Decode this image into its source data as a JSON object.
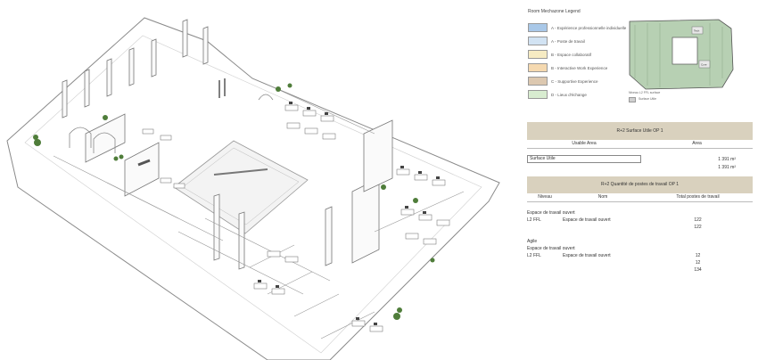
{
  "legend": {
    "title": "Room Mechazone Legend",
    "items": [
      {
        "label": "A - Expérience professionnelle individuelle",
        "color": "#a9c8e8"
      },
      {
        "label": "A - Poste de travail",
        "color": "#d2e3f3"
      },
      {
        "label": "B - Espace collaboratif",
        "color": "#f6ebc3"
      },
      {
        "label": "B - Interactive Work Experience",
        "color": "#f5d9b0"
      },
      {
        "label": "C - Supportive Experience",
        "color": "#dcc8b0"
      },
      {
        "label": "D - Lieux d'échange",
        "color": "#d8ecd0"
      }
    ]
  },
  "mini_plan": {
    "legend_label": "Niveau L2 FFL surface",
    "legend_item": "Surface Utile",
    "labels": [
      "Tech",
      "Core"
    ],
    "fill_color": "#b7d0b3"
  },
  "surface_table": {
    "title": "R+2 Surface Utile OP 1",
    "headers": [
      "Usable Area",
      "Area"
    ],
    "rows": [
      {
        "label": "Surface Utile",
        "value": "1 391 m²"
      }
    ],
    "total": "1 391 m²"
  },
  "workstation_table": {
    "title": "R+2 Quantité de postes de travail OP 1",
    "headers": [
      "Niveau",
      "Nom",
      "Total postes de travail"
    ],
    "groups": [
      {
        "group": "Espace de travail ouvert",
        "rows": [
          {
            "niveau": "L2 FFL",
            "nom": "Espace de travail ouvert",
            "total": "122"
          }
        ],
        "subtotal": "122"
      },
      {
        "group": "Agile",
        "subgroup": "Espace de travail ouvert",
        "rows": [
          {
            "niveau": "L2 FFL",
            "nom": "Espace de travail ouvert",
            "total": "12"
          }
        ],
        "subtotal": "12"
      }
    ],
    "grand_total": "134"
  }
}
